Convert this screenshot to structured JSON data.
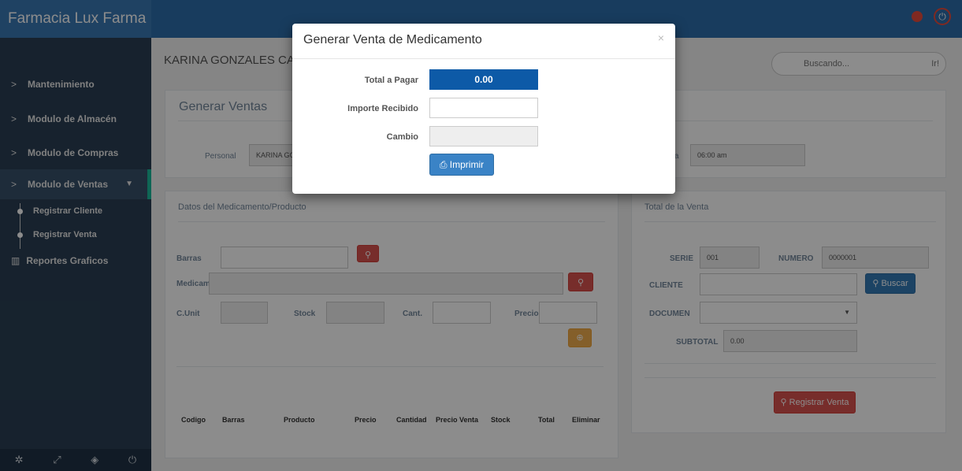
{
  "app": {
    "brand": "Farmacia Lux Farma"
  },
  "sidebar": {
    "items": [
      {
        "label": "Mantenimiento"
      },
      {
        "label": "Modulo de Almacén"
      },
      {
        "label": "Modulo de Compras"
      },
      {
        "label": "Modulo de Ventas"
      }
    ],
    "sub_items": [
      {
        "label": "Registrar Cliente"
      },
      {
        "label": "Registrar Venta"
      }
    ],
    "reports": "Reportes Graficos"
  },
  "header": {
    "user_name": "KARINA GONZALES CAR",
    "search_placeholder": "Buscando...",
    "search_button": "Ir!"
  },
  "ventas": {
    "title": "Generar Ventas",
    "personal_label": "Personal",
    "personal_value": "KARINA GON",
    "hora_label": "a",
    "hora_value": "06:00 am"
  },
  "producto": {
    "title": "Datos del Medicamento/Producto",
    "barras_label": "Barras",
    "medicam_label": "Medicam.",
    "cunit_label": "C.Unit",
    "stock_label": "Stock",
    "cant_label": "Cant.",
    "precio_label": "Precio",
    "table_headers": [
      "Codigo",
      "Barras",
      "Producto",
      "Precio",
      "Cantidad",
      "Precio Venta",
      "Stock",
      "Total",
      "Eliminar"
    ]
  },
  "total_venta": {
    "title": "Total de la Venta",
    "serie_label": "SERIE",
    "serie_value": "001",
    "numero_label": "NUMERO",
    "numero_value": "0000001",
    "cliente_label": "CLIENTE",
    "buscar_button": "Buscar",
    "documen_label": "DOCUMEN",
    "subtotal_label": "SUBTOTAL",
    "subtotal_value": "0.00",
    "registrar_button": "Registrar Venta"
  },
  "modal": {
    "title": "Generar Venta de Medicamento",
    "close": "×",
    "total_label": "Total a Pagar",
    "total_value": "0.00",
    "importe_label": "Importe Recibido",
    "importe_value": "",
    "cambio_label": "Cambio",
    "cambio_value": "",
    "print_button": "Imprimir"
  }
}
